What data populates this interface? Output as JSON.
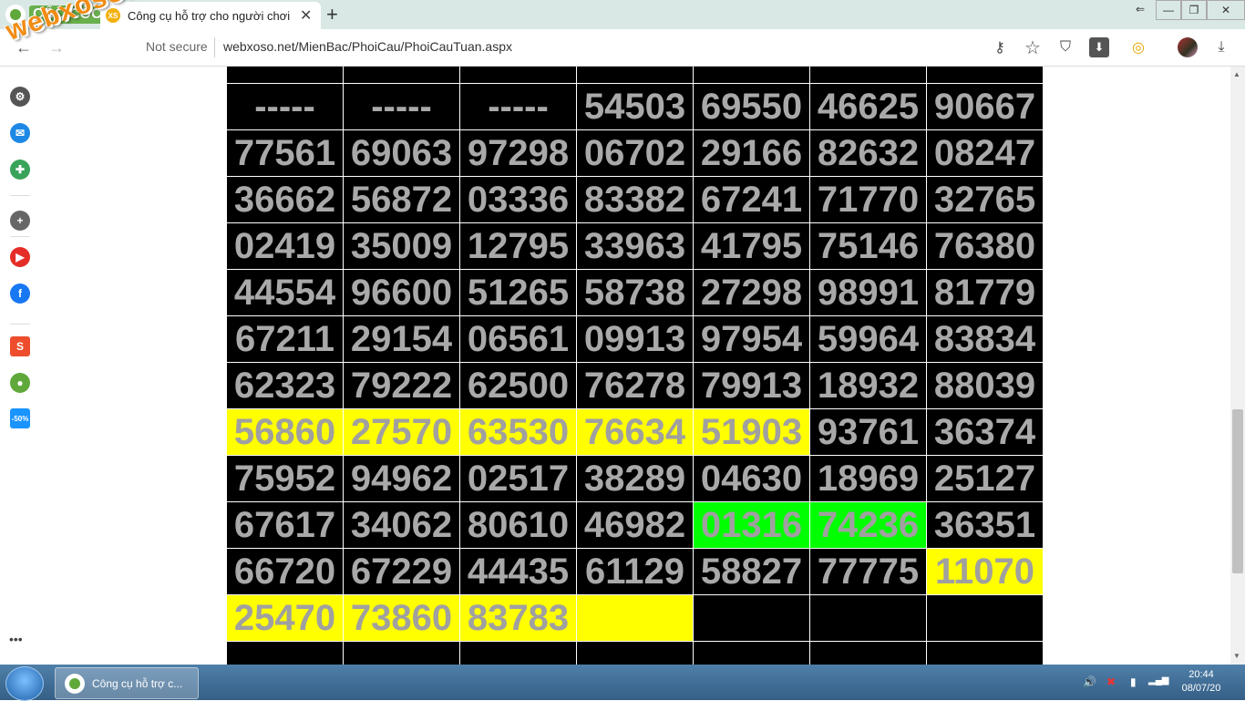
{
  "browser": {
    "brand": "CỐC CỐC",
    "tab": {
      "favicon": "XS",
      "title": "Công cụ hỗ trợ cho người chơi",
      "close": "✕"
    },
    "new_tab": "+",
    "window_controls": {
      "back_arrow": "⇐",
      "minimize": "—",
      "maximize": "❐",
      "close": "✕"
    },
    "address": {
      "back": "←",
      "forward": "→",
      "info": "Not secure",
      "url": "webxoso.net/MienBac/PhoiCau/PhoiCauTuan.aspx"
    },
    "toolbar_icons": {
      "key": "⚷",
      "star": "☆",
      "shield": "⛉",
      "download": "⬇",
      "extension": "◎",
      "menu_download": "⤓"
    }
  },
  "watermark": "webxoso.net",
  "sidebar": {
    "icons": [
      {
        "name": "settings-icon",
        "glyph": "⚙",
        "color": "#555555"
      },
      {
        "name": "messenger-icon",
        "glyph": "✉",
        "color": "#1e88e5"
      },
      {
        "name": "gamepad-icon",
        "glyph": "✚",
        "color": "#3aa35b"
      },
      {
        "name": "add-icon",
        "glyph": "+",
        "color": "#666666"
      },
      {
        "name": "youtube-icon",
        "glyph": "▶",
        "color": "#e52d27"
      },
      {
        "name": "facebook-icon",
        "glyph": "f",
        "color": "#1877f2"
      },
      {
        "name": "shopee-icon",
        "glyph": "S",
        "color": "#ee4d2d"
      },
      {
        "name": "coccoc-icon",
        "glyph": "●",
        "color": "#5fa83a"
      },
      {
        "name": "tiki-icon",
        "glyph": "-50%",
        "color": "#1a94ff"
      }
    ],
    "more": "•••"
  },
  "grid": {
    "rows": [
      [
        {
          "v": "-----",
          "c": "black"
        },
        {
          "v": "-----",
          "c": "black"
        },
        {
          "v": "-----",
          "c": "black"
        },
        {
          "v": "54503",
          "c": "black"
        },
        {
          "v": "69550",
          "c": "black"
        },
        {
          "v": "46625",
          "c": "black"
        },
        {
          "v": "90667",
          "c": "black"
        }
      ],
      [
        {
          "v": "77561",
          "c": "black"
        },
        {
          "v": "69063",
          "c": "black"
        },
        {
          "v": "97298",
          "c": "black"
        },
        {
          "v": "06702",
          "c": "black"
        },
        {
          "v": "29166",
          "c": "black"
        },
        {
          "v": "82632",
          "c": "black"
        },
        {
          "v": "08247",
          "c": "black"
        }
      ],
      [
        {
          "v": "36662",
          "c": "black"
        },
        {
          "v": "56872",
          "c": "black"
        },
        {
          "v": "03336",
          "c": "black"
        },
        {
          "v": "83382",
          "c": "black"
        },
        {
          "v": "67241",
          "c": "black"
        },
        {
          "v": "71770",
          "c": "black"
        },
        {
          "v": "32765",
          "c": "black"
        }
      ],
      [
        {
          "v": "02419",
          "c": "black"
        },
        {
          "v": "35009",
          "c": "black"
        },
        {
          "v": "12795",
          "c": "black"
        },
        {
          "v": "33963",
          "c": "black"
        },
        {
          "v": "41795",
          "c": "black"
        },
        {
          "v": "75146",
          "c": "black"
        },
        {
          "v": "76380",
          "c": "black"
        }
      ],
      [
        {
          "v": "44554",
          "c": "black"
        },
        {
          "v": "96600",
          "c": "black"
        },
        {
          "v": "51265",
          "c": "black"
        },
        {
          "v": "58738",
          "c": "black"
        },
        {
          "v": "27298",
          "c": "black"
        },
        {
          "v": "98991",
          "c": "black"
        },
        {
          "v": "81779",
          "c": "black"
        }
      ],
      [
        {
          "v": "67211",
          "c": "black"
        },
        {
          "v": "29154",
          "c": "black"
        },
        {
          "v": "06561",
          "c": "black"
        },
        {
          "v": "09913",
          "c": "black"
        },
        {
          "v": "97954",
          "c": "black"
        },
        {
          "v": "59964",
          "c": "black"
        },
        {
          "v": "83834",
          "c": "black"
        }
      ],
      [
        {
          "v": "62323",
          "c": "black"
        },
        {
          "v": "79222",
          "c": "black"
        },
        {
          "v": "62500",
          "c": "black"
        },
        {
          "v": "76278",
          "c": "black"
        },
        {
          "v": "79913",
          "c": "black"
        },
        {
          "v": "18932",
          "c": "black"
        },
        {
          "v": "88039",
          "c": "black"
        }
      ],
      [
        {
          "v": "56860",
          "c": "yellow"
        },
        {
          "v": "27570",
          "c": "yellow"
        },
        {
          "v": "63530",
          "c": "yellow"
        },
        {
          "v": "76634",
          "c": "yellow"
        },
        {
          "v": "51903",
          "c": "yellow"
        },
        {
          "v": "93761",
          "c": "black"
        },
        {
          "v": "36374",
          "c": "black"
        }
      ],
      [
        {
          "v": "75952",
          "c": "black"
        },
        {
          "v": "94962",
          "c": "black"
        },
        {
          "v": "02517",
          "c": "black"
        },
        {
          "v": "38289",
          "c": "black"
        },
        {
          "v": "04630",
          "c": "black"
        },
        {
          "v": "18969",
          "c": "black"
        },
        {
          "v": "25127",
          "c": "black"
        }
      ],
      [
        {
          "v": "67617",
          "c": "black"
        },
        {
          "v": "34062",
          "c": "black"
        },
        {
          "v": "80610",
          "c": "black"
        },
        {
          "v": "46982",
          "c": "black"
        },
        {
          "v": "01316",
          "c": "green"
        },
        {
          "v": "74236",
          "c": "green"
        },
        {
          "v": "36351",
          "c": "black"
        }
      ],
      [
        {
          "v": "66720",
          "c": "black"
        },
        {
          "v": "67229",
          "c": "black"
        },
        {
          "v": "44435",
          "c": "black"
        },
        {
          "v": "61129",
          "c": "black"
        },
        {
          "v": "58827",
          "c": "black"
        },
        {
          "v": "77775",
          "c": "black"
        },
        {
          "v": "11070",
          "c": "yellow"
        }
      ],
      [
        {
          "v": "25470",
          "c": "yellow"
        },
        {
          "v": "73860",
          "c": "yellow"
        },
        {
          "v": "83783",
          "c": "yellow"
        },
        {
          "v": "",
          "c": "yellow"
        },
        {
          "v": "",
          "c": "black"
        },
        {
          "v": "",
          "c": "black"
        },
        {
          "v": "",
          "c": "black"
        }
      ]
    ]
  },
  "taskbar": {
    "app_label": "Công cụ hỗ trợ c...",
    "tray": {
      "volume": "🔊",
      "network_error": "✖",
      "power": "▮",
      "signal": "▂▄▆"
    },
    "time": "20:44",
    "date": "08/07/20"
  }
}
